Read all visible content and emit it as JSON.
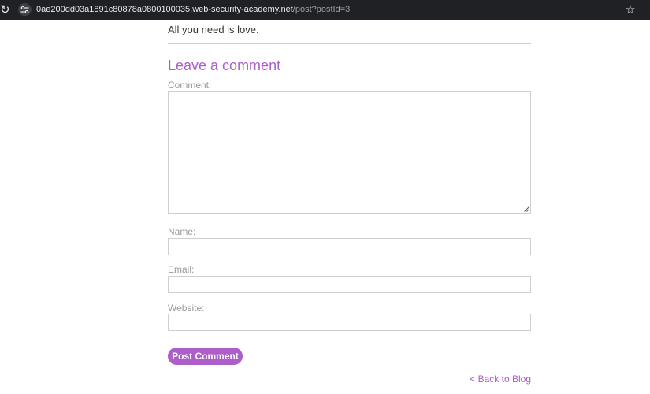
{
  "browser": {
    "url_host": "0ae200dd03a1891c80878a0800100035.web-security-academy.net",
    "url_path": "/post?postId=3",
    "reload_icon": "reload-icon",
    "site_info_icon": "site-info-icon",
    "bookmark_icon": "star-icon"
  },
  "post": {
    "closing_text": "All you need is love."
  },
  "comment_form": {
    "heading": "Leave a comment",
    "comment_label": "Comment:",
    "comment_value": "",
    "name_label": "Name:",
    "name_value": "",
    "email_label": "Email:",
    "email_value": "",
    "website_label": "Website:",
    "website_value": "",
    "submit_label": "Post Comment"
  },
  "navigation": {
    "back_link": "< Back to Blog"
  },
  "colors": {
    "accent": "#ad5ec8",
    "label": "#999999",
    "border": "#cbd0d1",
    "chrome_bg": "#202124"
  }
}
